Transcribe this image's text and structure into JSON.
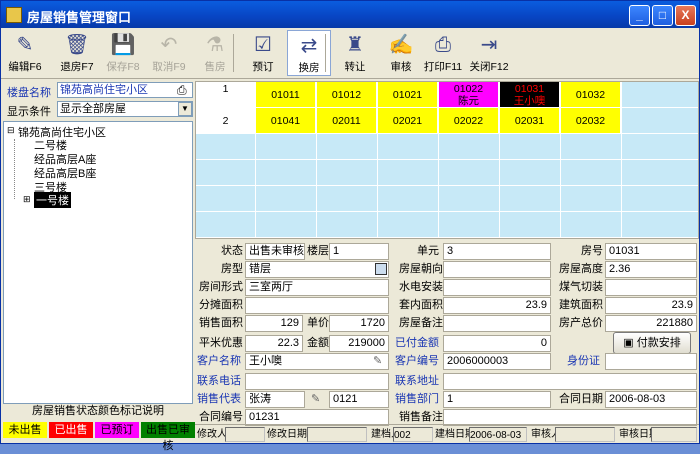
{
  "window": {
    "title": "房屋销售管理窗口",
    "min": "_",
    "max": "□",
    "close": "X"
  },
  "toolbar": [
    {
      "label": "编辑F6",
      "icon": "edit-icon",
      "glyph": "✎",
      "disabled": false
    },
    {
      "label": "退房F7",
      "icon": "trash-icon",
      "glyph": "🗑",
      "disabled": false
    },
    {
      "label": "保存F8",
      "icon": "save-icon",
      "glyph": "💾",
      "disabled": true
    },
    {
      "label": "取消F9",
      "icon": "undo-icon",
      "glyph": "↶",
      "disabled": true
    },
    {
      "label": "售房",
      "icon": "sell-icon",
      "glyph": "⚗",
      "disabled": true
    },
    {
      "label": "预订",
      "icon": "reserve-icon",
      "glyph": "☑",
      "disabled": false
    },
    {
      "label": "换房",
      "icon": "swap-icon",
      "glyph": "⇄",
      "disabled": false
    },
    {
      "label": "转让",
      "icon": "transfer-icon",
      "glyph": "♜",
      "disabled": false
    },
    {
      "label": "审核",
      "icon": "audit-icon",
      "glyph": "✍",
      "disabled": false
    },
    {
      "label": "打印F11",
      "icon": "printer-icon",
      "glyph": "⎙",
      "disabled": false
    },
    {
      "label": "关闭F12",
      "icon": "exit-icon",
      "glyph": "⇥",
      "disabled": false
    }
  ],
  "left": {
    "project_label": "楼盘名称",
    "project_value": "锦苑高尚住宅小区",
    "filter_label": "显示条件",
    "filter_value": "显示全部房屋",
    "tree": {
      "root": "锦苑高尚住宅小区",
      "items": [
        "二号楼",
        "经品高层A座",
        "经品高层B座",
        "三号楼",
        "一号楼"
      ]
    },
    "legend_title": "房屋销售状态颜色标记说明",
    "legend": [
      {
        "label": "未出售",
        "bg": "#ffff00",
        "fg": "#000000"
      },
      {
        "label": "已出售",
        "bg": "#ff0000",
        "fg": "#ffffff"
      },
      {
        "label": "已预订",
        "bg": "#ff00ff",
        "fg": "#000000"
      },
      {
        "label": "出售已审核",
        "bg": "#008000",
        "fg": "#000000"
      }
    ]
  },
  "grid": {
    "rows": [
      {
        "floor": "1",
        "units": [
          {
            "code": "01011",
            "name": "",
            "bg": "#ffff00",
            "fg": "#000000"
          },
          {
            "code": "01012",
            "name": "",
            "bg": "#ffff00",
            "fg": "#000000"
          },
          {
            "code": "01021",
            "name": "",
            "bg": "#ffff00",
            "fg": "#000000"
          },
          {
            "code": "01022",
            "name": "陈元",
            "bg": "#ff00ff",
            "fg": "#000000"
          },
          {
            "code": "01031",
            "name": "王小噢",
            "bg": "#000000",
            "fg": "#ff0000"
          },
          {
            "code": "01032",
            "name": "",
            "bg": "#ffff00",
            "fg": "#000000"
          }
        ]
      },
      {
        "floor": "2",
        "units": [
          {
            "code": "01041",
            "name": "",
            "bg": "#ffff00",
            "fg": "#000000"
          },
          {
            "code": "02011",
            "name": "",
            "bg": "#ffff00",
            "fg": "#000000"
          },
          {
            "code": "02021",
            "name": "",
            "bg": "#ffff00",
            "fg": "#000000"
          },
          {
            "code": "02022",
            "name": "",
            "bg": "#ffff00",
            "fg": "#000000"
          },
          {
            "code": "02031",
            "name": "",
            "bg": "#ffff00",
            "fg": "#000000"
          },
          {
            "code": "02032",
            "name": "",
            "bg": "#ffff00",
            "fg": "#000000"
          }
        ]
      }
    ]
  },
  "form": {
    "status_label": "状态",
    "status_value": "出售未审核",
    "floor_label": "楼层",
    "floor_value": "1",
    "unit_label": "单元",
    "unit_value": "3",
    "room_no_label": "房号",
    "room_no_value": "01031",
    "type_label": "房型",
    "type_value": "错层",
    "orient_label": "房屋朝向",
    "orient_value": "",
    "height_label": "房屋高度",
    "height_value": "2.36",
    "form_label": "房间形式",
    "form_value": "三室两厅",
    "water_label": "水电安装",
    "water_value": "",
    "gas_label": "煤气切装",
    "gas_value": "",
    "share_label": "分摊面积",
    "share_value": "",
    "inner_label": "套内面积",
    "inner_value": "23.9",
    "build_label": "建筑面积",
    "build_value": "23.9",
    "sale_area_label": "销售面积",
    "sale_area_value": "129",
    "price_label": "单价",
    "price_value": "1720",
    "note_label": "房屋备注",
    "note_value": "",
    "total_label": "房产总价",
    "total_value": "221880",
    "discount_label": "平米优惠",
    "discount_value": "22.3",
    "amount_label": "金额",
    "amount_value": "219000",
    "paid_label": "已付金额",
    "paid_value": "0",
    "pay_button": "付款安排",
    "customer_label": "客户名称",
    "customer_value": "王小噢",
    "cust_no_label": "客户编号",
    "cust_no_value": "2006000003",
    "id_label": "身份证",
    "id_value": "",
    "phone_label": "联系电话",
    "phone_value": "",
    "addr_label": "联系地址",
    "addr_value": "",
    "agent_label": "销售代表",
    "agent_value": "张涛",
    "agent_code": "0121",
    "dept_label": "销售部门",
    "dept_value": "1",
    "date_label": "合同日期",
    "date_value": "2006-08-03",
    "contract_label": "合同编号",
    "contract_value": "01231",
    "sale_note_label": "销售备注",
    "sale_note_value": ""
  },
  "status": {
    "modifier_label": "修改人",
    "modifier_value": "",
    "mod_date_label": "修改日期",
    "mod_date_value": "",
    "creator_label": "建档人",
    "creator_value": "002",
    "create_date_label": "建档日期",
    "create_date_value": "2006-08-03",
    "auditor_label": "审核人",
    "auditor_value": "",
    "audit_date_label": "审核日期",
    "audit_date_value": ""
  }
}
